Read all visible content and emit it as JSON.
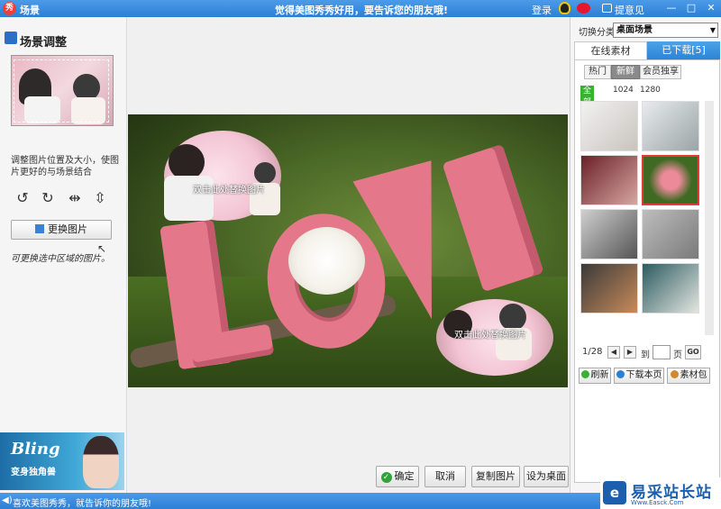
{
  "titlebar": {
    "app_icon": "秀",
    "title": "场景",
    "slogan": "觉得美图秀秀好用，要告诉您的朋友哦!",
    "login": "登录",
    "feedback": "提意见",
    "minimize": "—",
    "maximize": "□",
    "close": "✕"
  },
  "left": {
    "heading": "场景调整",
    "description": "调整图片位置及大小，使图片更好的与场景结合",
    "tools": {
      "rotate_left": "↺",
      "rotate_right": "↻",
      "flip_horizontal": "⇹",
      "flip_vertical": "⇳"
    },
    "replace_button": "更换图片",
    "handwritten_note": "可更换选中区域的图片。",
    "ad": {
      "title": "Bling",
      "subtitle": "变身独角兽"
    }
  },
  "canvas": {
    "hint_top": "双击此处替换图片",
    "hint_bottom": "双击此处替换图片"
  },
  "buttons": {
    "confirm": "确定",
    "cancel": "取消",
    "copy": "复制图片",
    "set_desktop": "设为桌面"
  },
  "right": {
    "category_label": "切换分类",
    "category_value": "桌面场景",
    "tab_online": "在线素材",
    "tab_downloaded": "已下载[5]",
    "filters": [
      "热门",
      "新鲜",
      "会员独享"
    ],
    "active_filter": "新鲜",
    "resolutions": [
      "全部",
      "1024",
      "1280"
    ],
    "pager": {
      "page": "1/28",
      "to_label": "到",
      "page_unit": "页",
      "go": "GO"
    },
    "actions": {
      "refresh": "刷新",
      "download_page": "下载本页",
      "package": "素材包"
    }
  },
  "statusbar": {
    "message": "喜欢美图秀秀，就告诉你的朋友哦!"
  },
  "watermark": {
    "logo": "e",
    "name": "易采站长站",
    "url": "Www.Easck.Com"
  },
  "colors": {
    "accent": "#2d7fd6",
    "love_pink": "#e4788a",
    "selection_red": "#e23a3a",
    "green": "#38b230"
  }
}
